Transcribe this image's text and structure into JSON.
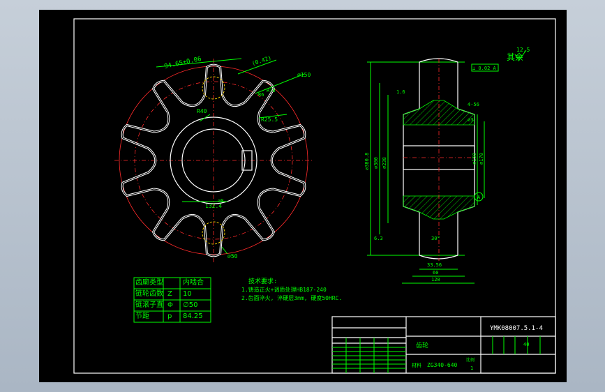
{
  "drawing": {
    "number": "YMK08007.5.1-4",
    "part_name": "齿轮",
    "material": "ZG340-640",
    "material_label": "材料",
    "scale_label": "比例",
    "scale": "1",
    "quantity": "1",
    "sheet_num": "1",
    "mass_label": "40"
  },
  "params_table": [
    {
      "name": "齿廓类型",
      "symbol": "",
      "value": "内啮合"
    },
    {
      "name": "链轮齿数",
      "symbol": "Z",
      "value": "10"
    },
    {
      "name": "链滚子直径",
      "symbol": "Φ",
      "value": "∅50"
    },
    {
      "name": "节距",
      "symbol": "p",
      "value": "84.25"
    }
  ],
  "tech_req": {
    "title": "技术要求:",
    "items": [
      "1.铸造正火+调质处理HB187-240",
      "2.齿面淬火, 淬硬层3mm, 硬度50HRC."
    ]
  },
  "roughness": {
    "label": "其余",
    "value": "12.5"
  },
  "front_view_dims": {
    "arc": "94.65±0.06",
    "tol": "(0.42)",
    "dia_outer": "∅150",
    "r40": "R40",
    "r25": "R25.5",
    "angle": "R6",
    "dims_small": "R70",
    "width": "132.4",
    "width2": "∅0",
    "bore": "∅50"
  },
  "side_view_dims": {
    "gt": "⊥ 0.02 A",
    "d1": "∅380.8",
    "d2": "∅300",
    "d3": "∅238",
    "d4": "∅150",
    "d5": "∅170",
    "t1": "4-56",
    "t2": "∅3",
    "a": "A",
    "ang": "30°",
    "w1": "33.56",
    "w2": "60",
    "w3": "120",
    "s1": "6.3",
    "s2": "1.6"
  },
  "title_block": {
    "cells": [
      "标记",
      "处数",
      "分区",
      "更改文件号",
      "签名",
      "年月日",
      "设计",
      "标准化",
      "审核",
      "工艺",
      "批准",
      "阶段标记",
      "重量",
      "比例",
      "共 张",
      "第 张"
    ]
  }
}
